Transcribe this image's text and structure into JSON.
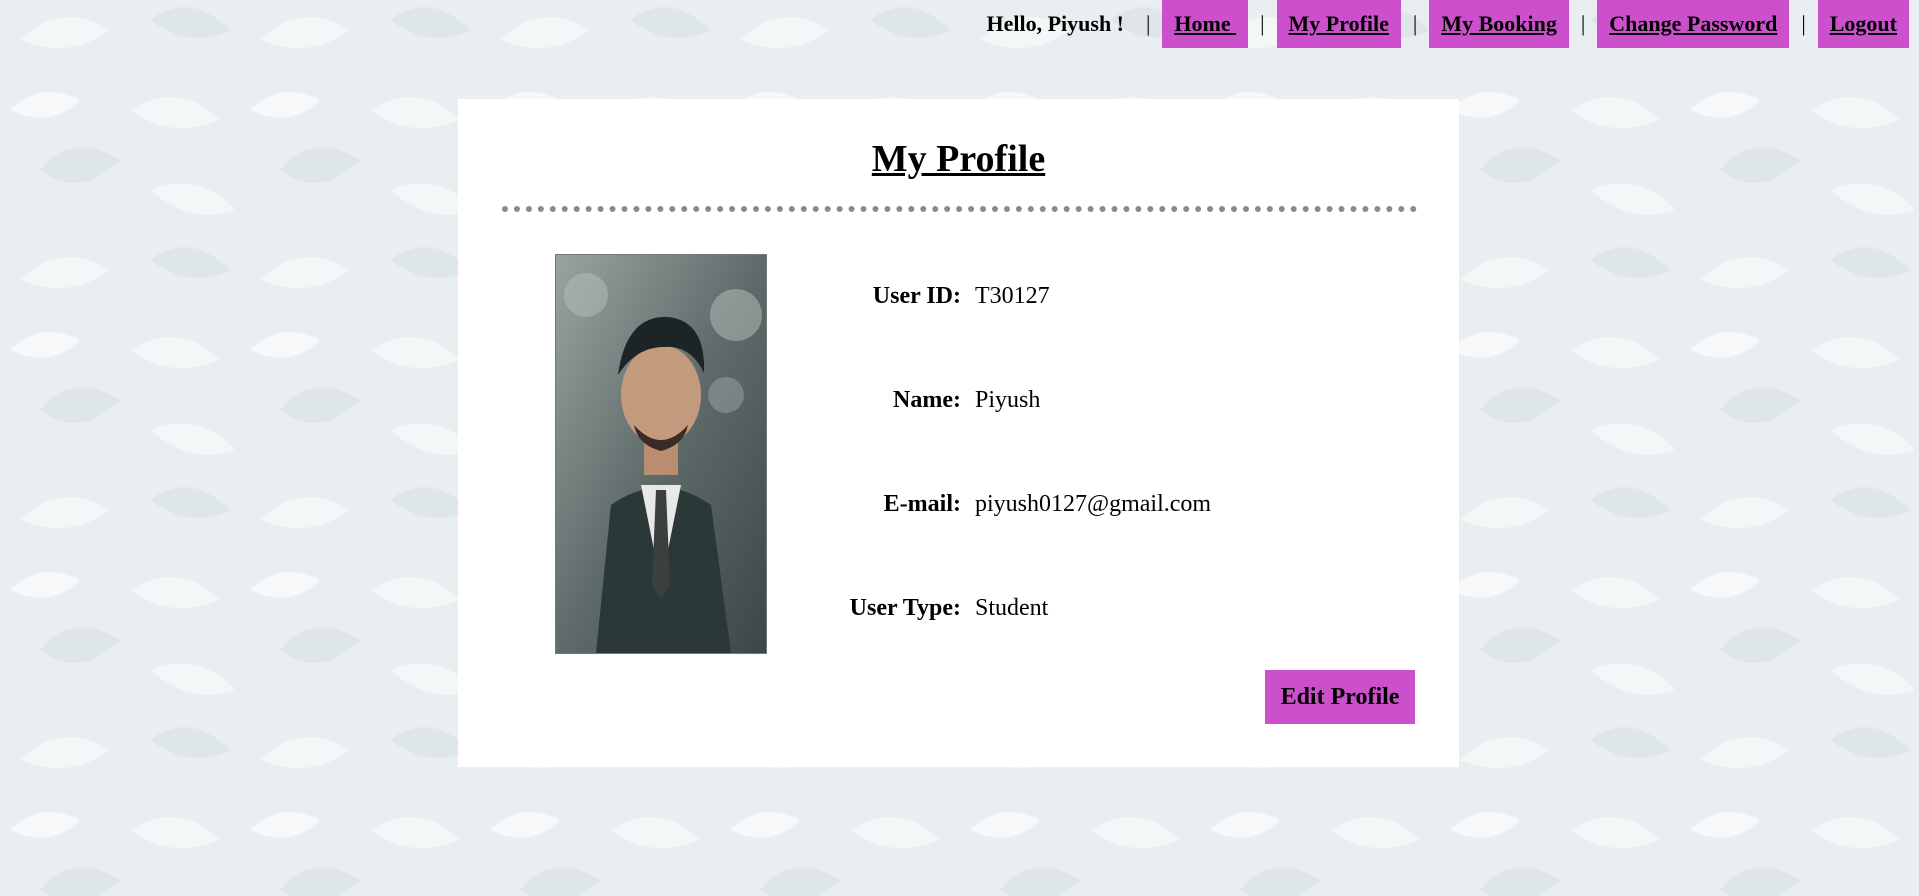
{
  "nav": {
    "greeting": "Hello, Piyush !",
    "separator": "|",
    "items": [
      {
        "label": "Home "
      },
      {
        "label": "My Profile"
      },
      {
        "label": "My Booking"
      },
      {
        "label": "Change Password"
      },
      {
        "label": "Logout"
      }
    ]
  },
  "profile": {
    "title": "My Profile",
    "fields": [
      {
        "label": "User ID:",
        "value": "T30127"
      },
      {
        "label": "Name:",
        "value": "Piyush"
      },
      {
        "label": "E-mail:",
        "value": "piyush0127@gmail.com"
      },
      {
        "label": "User Type:",
        "value": "Student"
      }
    ],
    "edit_label": "Edit Profile"
  },
  "colors": {
    "accent": "#cc4fcc",
    "background": "#e9eef0",
    "card": "#ffffff",
    "divider": "#8a8a8a"
  }
}
